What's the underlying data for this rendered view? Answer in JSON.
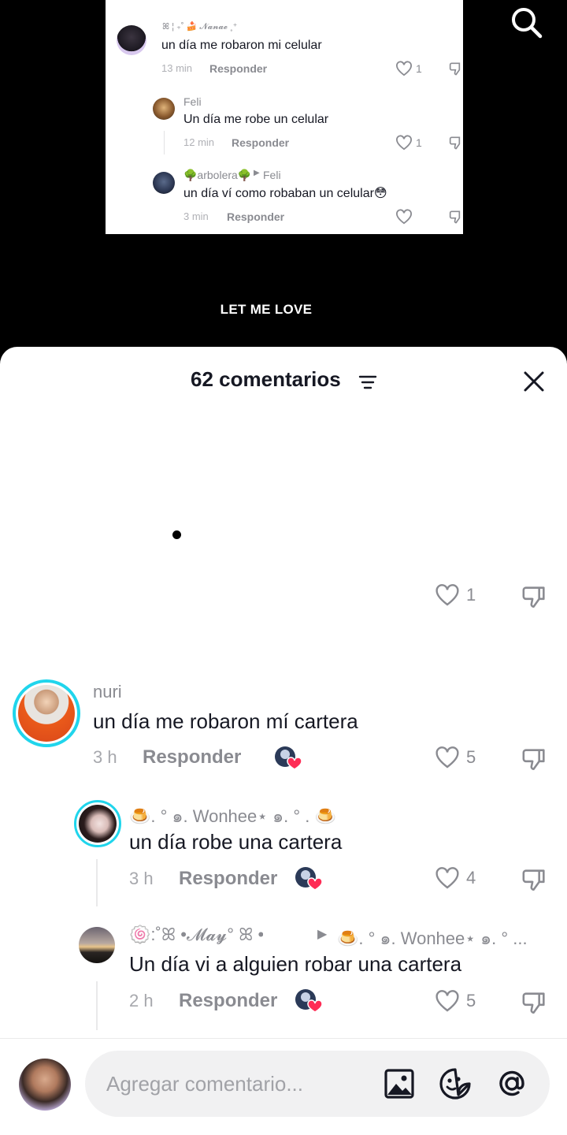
{
  "video": {
    "caption": "LET ME LOVE",
    "screenshot_comments": [
      {
        "user": "ꕤ ¦ ₊˚ 🍰 𝓝𝓪𝓷𝓪𝓮 ˳⁺",
        "text": "un día me robaron mi celular",
        "time": "13 min",
        "reply": "Responder",
        "likes": "1"
      },
      {
        "user": "Feli",
        "text": "Un día me robe un celular",
        "time": "12 min",
        "reply": "Responder",
        "likes": "1"
      },
      {
        "user": "🌳arbolera🌳",
        "reply_to": "Feli",
        "text": "un día ví como robaban un celular😳",
        "time": "3 min",
        "reply": "Responder",
        "likes": ""
      }
    ]
  },
  "sheet": {
    "title": "62 comentarios",
    "top_comment_likes": "1",
    "comments": [
      {
        "user": "nuri",
        "text": "un día me robaron mí cartera",
        "time": "3 h",
        "reply": "Responder",
        "likes": "5"
      },
      {
        "user": "🍮. ° ๑. Wonhee⋆ ๑. ° . 🍮",
        "text": "un día robe una cartera",
        "time": "3 h",
        "reply": "Responder",
        "likes": "4"
      },
      {
        "user": "🍥:˚ꕤ •𝓜𝓪𝔂° ꕤ •°:🍥",
        "reply_to": "🍮. ° ๑. Wonhee⋆ ๑. ° ...",
        "text": "Un día vi a alguien robar una cartera",
        "time": "2 h",
        "reply": "Responder",
        "likes": "5"
      }
    ]
  },
  "input": {
    "placeholder": "Agregar comentario..."
  },
  "colors": {
    "text": "#161823",
    "muted": "#8a8b91",
    "accent_heart": "#fe2c55",
    "avatar_ring": "#20d5ec"
  }
}
